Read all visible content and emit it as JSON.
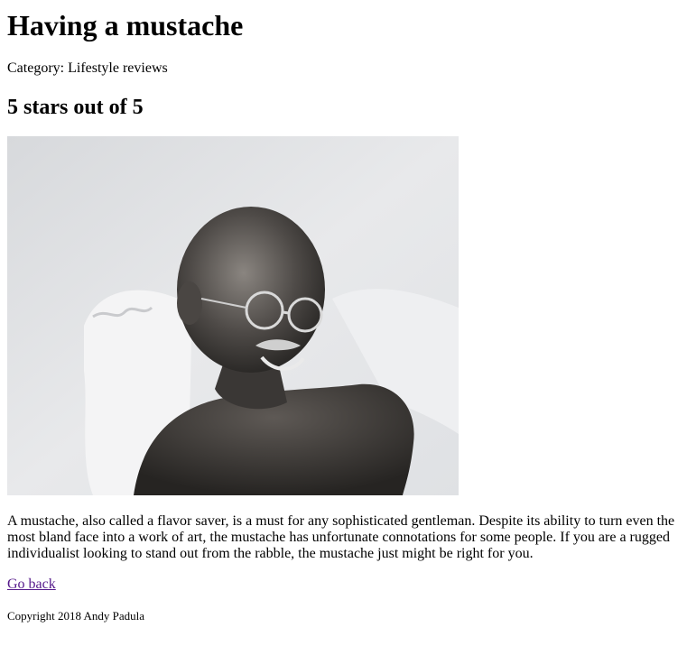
{
  "article": {
    "title": "Having a mustache",
    "category": "Category: Lifestyle reviews",
    "rating_heading": "5 stars out of 5",
    "image_alt": "Black and white photo of a smiling man with round glasses and a mustache",
    "body": "A mustache, also called a flavor saver, is a must for any sophisticated gentleman. Despite its ability to turn even the most bland face into a work of art, the mustache has unfortunate connotations for some people. If you are a rugged individualist looking to stand out from the rabble, the mustache just might be right for you.",
    "back_link": "Go back",
    "copyright": "Copyright 2018 Andy Padula"
  },
  "colors": {
    "link_visited": "#551a8b",
    "text": "#000000",
    "photo_background": "#e9eaec"
  }
}
